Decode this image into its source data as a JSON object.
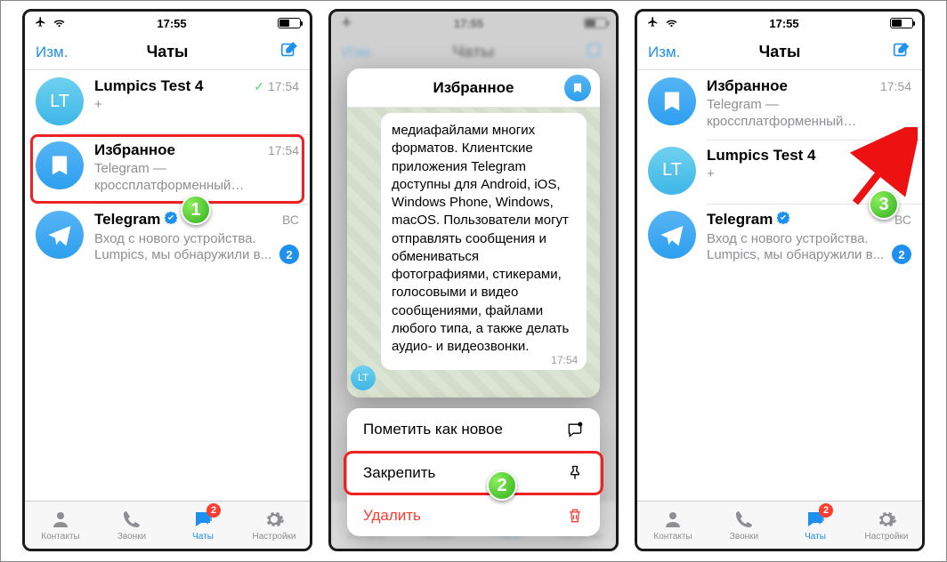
{
  "status": {
    "time": "17:55"
  },
  "header": {
    "edit": "Изм.",
    "title": "Чаты"
  },
  "tabs": {
    "contacts": "Контакты",
    "calls": "Звонки",
    "chats": "Чаты",
    "settings": "Настройки",
    "chats_badge": "2"
  },
  "frame1": {
    "chats": [
      {
        "avatar": "LT",
        "name": "Lumpics Test 4",
        "time": "17:54",
        "checked": true,
        "sub": "+"
      },
      {
        "name": "Избранное",
        "time": "17:54",
        "sub": "Telegram — кроссплатформенный мессенджер, позволяющи..."
      },
      {
        "name": "Telegram",
        "day": "ВС",
        "sub": "Вход с нового устройства. Lumpics, мы обнаружили в...",
        "unread": "2"
      }
    ]
  },
  "frame2": {
    "preview_title": "Избранное",
    "bubble_text": "медиафайлами многих форматов. Клиентские приложения Telegram доступны для Android, iOS, Windows Phone, Windows, macOS. Пользователи могут отправлять сообщения и обмениваться фотографиями, стикерами, голосовыми и видео сообщениями, файлами любого типа, а также делать аудио- и видеозвонки.",
    "bubble_time": "17:54",
    "preview_av": "LT",
    "actions": {
      "mark_new": "Пометить как новое",
      "pin": "Закрепить",
      "delete": "Удалить"
    }
  },
  "frame3": {
    "chats": [
      {
        "name": "Избранное",
        "time": "17:54",
        "sub": "Telegram — кроссплатформенный мессенджер, позво",
        "pinned": true
      },
      {
        "avatar": "LT",
        "name": "Lumpics Test 4",
        "time": "17:54",
        "checked": true,
        "sub": "+"
      },
      {
        "name": "Telegram",
        "day": "ВС",
        "sub": "Вход с нового устройства. Lumpics, мы обнаружили в...",
        "unread": "2"
      }
    ]
  },
  "steps": {
    "s1": "1",
    "s2": "2",
    "s3": "3"
  }
}
